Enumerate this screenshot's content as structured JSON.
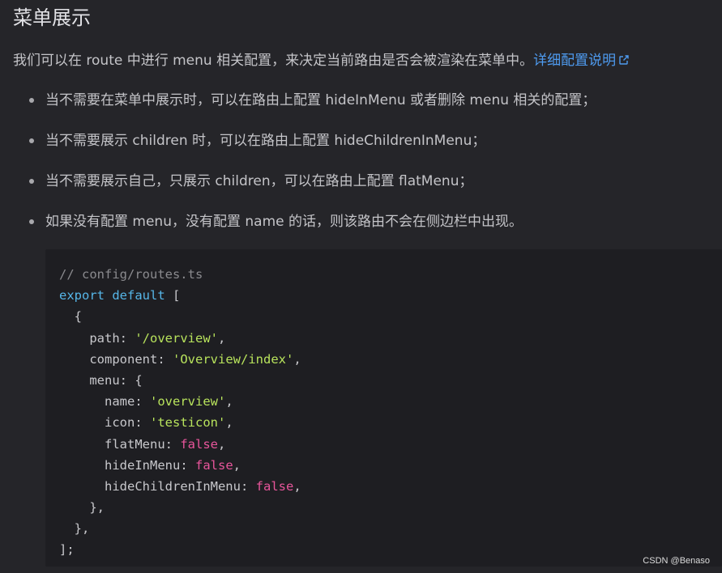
{
  "heading": "菜单展示",
  "intro": {
    "text": "我们可以在 route 中进行 menu 相关配置，来决定当前路由是否会被渲染在菜单中。",
    "link": "详细配置说明"
  },
  "bullets": [
    "当不需要在菜单中展示时，可以在路由上配置 hideInMenu 或者删除 menu 相关的配置；",
    "当不需要展示 children 时，可以在路由上配置 hideChildrenInMenu；",
    "当不需要展示自己，只展示 children，可以在路由上配置 flatMenu；",
    "如果没有配置 menu，没有配置 name 的话，则该路由不会在侧边栏中出现。"
  ],
  "code": {
    "comment": "// config/routes.ts",
    "kw_export": "export",
    "kw_default": "default",
    "open_bracket": "[",
    "open_brace": "{",
    "path_key": "path",
    "path_val": "'/overview'",
    "component_key": "component",
    "component_val": "'Overview/index'",
    "menu_key": "menu",
    "name_key": "name",
    "name_val": "'overview'",
    "icon_key": "icon",
    "icon_val": "'testicon'",
    "flatMenu_key": "flatMenu",
    "flatMenu_val": "false",
    "hideInMenu_key": "hideInMenu",
    "hideInMenu_val": "false",
    "hideChildrenInMenu_key": "hideChildrenInMenu",
    "hideChildrenInMenu_val": "false",
    "close_inner": "},",
    "close_obj": "},",
    "close_array": "];"
  },
  "watermark": "CSDN @Benaso",
  "colors": {
    "background": "#252529",
    "code_background": "#1e1e22",
    "link": "#4e9bf0",
    "keyword": "#56b6e8",
    "string": "#b8e35c",
    "boolean": "#e8559b",
    "comment": "#8a8a8e"
  },
  "icons": {
    "external_link": "external-link-icon",
    "bullet": "bullet-dot-icon"
  }
}
